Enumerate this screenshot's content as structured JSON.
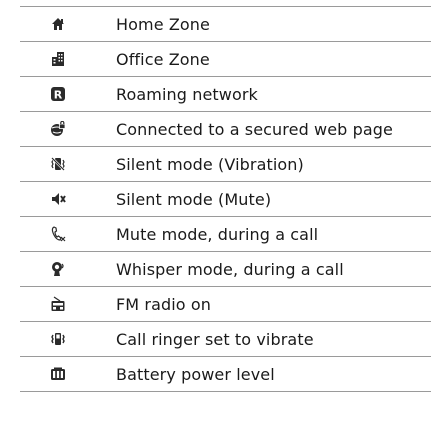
{
  "icon_rows": [
    {
      "icon": "home-zone-icon",
      "description": "Home Zone"
    },
    {
      "icon": "office-zone-icon",
      "description": "Office Zone"
    },
    {
      "icon": "roaming-network-icon",
      "description": "Roaming network"
    },
    {
      "icon": "secure-web-icon",
      "description": "Connected to a secured web page"
    },
    {
      "icon": "silent-vibration-icon",
      "description": "Silent mode (Vibration)"
    },
    {
      "icon": "silent-mute-icon",
      "description": "Silent mode (Mute)"
    },
    {
      "icon": "call-mute-icon",
      "description": "Mute mode, during a call"
    },
    {
      "icon": "whisper-mode-icon",
      "description": "Whisper mode, during a call"
    },
    {
      "icon": "fm-radio-icon",
      "description": "FM radio on"
    },
    {
      "icon": "vibrate-ringer-icon",
      "description": "Call ringer set to vibrate"
    },
    {
      "icon": "battery-level-icon",
      "description": "Battery power level"
    }
  ],
  "colors": {
    "icon": "#2b2b2b",
    "rule": "#9a9a9a",
    "text": "#1a1a1a"
  }
}
